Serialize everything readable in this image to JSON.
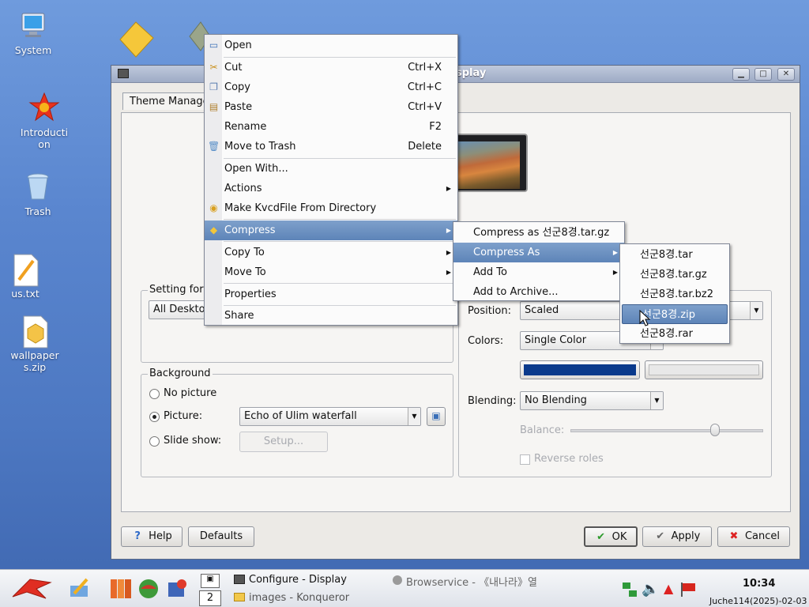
{
  "desktop": {
    "icons": [
      {
        "label": "System"
      },
      {
        "label": "Introduction"
      },
      {
        "label": "Trash"
      },
      {
        "label": "us.txt"
      },
      {
        "label": "wallpapers.zip"
      }
    ]
  },
  "dialog": {
    "title": "splay",
    "tab_label": "Theme Manage",
    "setting_group_label": "Setting for d",
    "setting_combo_value": "All Desktop",
    "background_group_label": "Background",
    "no_picture_label": "No picture",
    "picture_label": "Picture:",
    "picture_value": "Echo of Ulim waterfall",
    "slideshow_label": "Slide show:",
    "setup_label": "Setup...",
    "position_label": "Position:",
    "position_value": "Scaled",
    "colors_label": "Colors:",
    "colors_value": "Single Color",
    "color1": "#0a3a8c",
    "color2": "#e8e8e8",
    "blending_label": "Blending:",
    "blending_value": "No Blending",
    "balance_label": "Balance:",
    "balance_fraction": 0.75,
    "reverse_roles_label": "Reverse roles",
    "help_label": "Help",
    "defaults_label": "Defaults",
    "ok_label": "OK",
    "apply_label": "Apply",
    "cancel_label": "Cancel"
  },
  "context_menu": {
    "items": [
      {
        "label": "Open",
        "icon": "window-icon"
      },
      {
        "label": "Cut",
        "shortcut": "Ctrl+X",
        "icon": "scissors-icon"
      },
      {
        "label": "Copy",
        "shortcut": "Ctrl+C",
        "icon": "copy-icon"
      },
      {
        "label": "Paste",
        "shortcut": "Ctrl+V",
        "icon": "paste-icon"
      },
      {
        "label": "Rename",
        "shortcut": "F2"
      },
      {
        "label": "Move to Trash",
        "shortcut": "Delete",
        "icon": "trash-icon"
      },
      {
        "label": "Open With..."
      },
      {
        "label": "Actions"
      },
      {
        "label": "Make KvcdFile From Directory",
        "icon": "disc-icon"
      },
      {
        "label": "Compress",
        "icon": "archive-icon"
      },
      {
        "label": "Copy To"
      },
      {
        "label": "Move To"
      },
      {
        "label": "Properties"
      },
      {
        "label": "Share"
      }
    ]
  },
  "compress_menu": {
    "items": [
      {
        "label": "Compress as 선군8경.tar.gz"
      },
      {
        "label": "Compress As"
      },
      {
        "label": "Add To"
      },
      {
        "label": "Add to Archive..."
      }
    ]
  },
  "compress_as_menu": {
    "items": [
      {
        "label": "선군8경.tar"
      },
      {
        "label": "선군8경.tar.gz"
      },
      {
        "label": "선군8경.tar.bz2"
      },
      {
        "label": "선군8경.zip"
      },
      {
        "label": "선군8경.rar"
      }
    ]
  },
  "taskbar": {
    "desktop_number": "2",
    "task1": "Configure - Display",
    "task2": "images - Konqueror",
    "task3": "Browservice - 《내나라》열",
    "clock_time": "10:34",
    "clock_date": "Juche114(2025)-02-03"
  }
}
